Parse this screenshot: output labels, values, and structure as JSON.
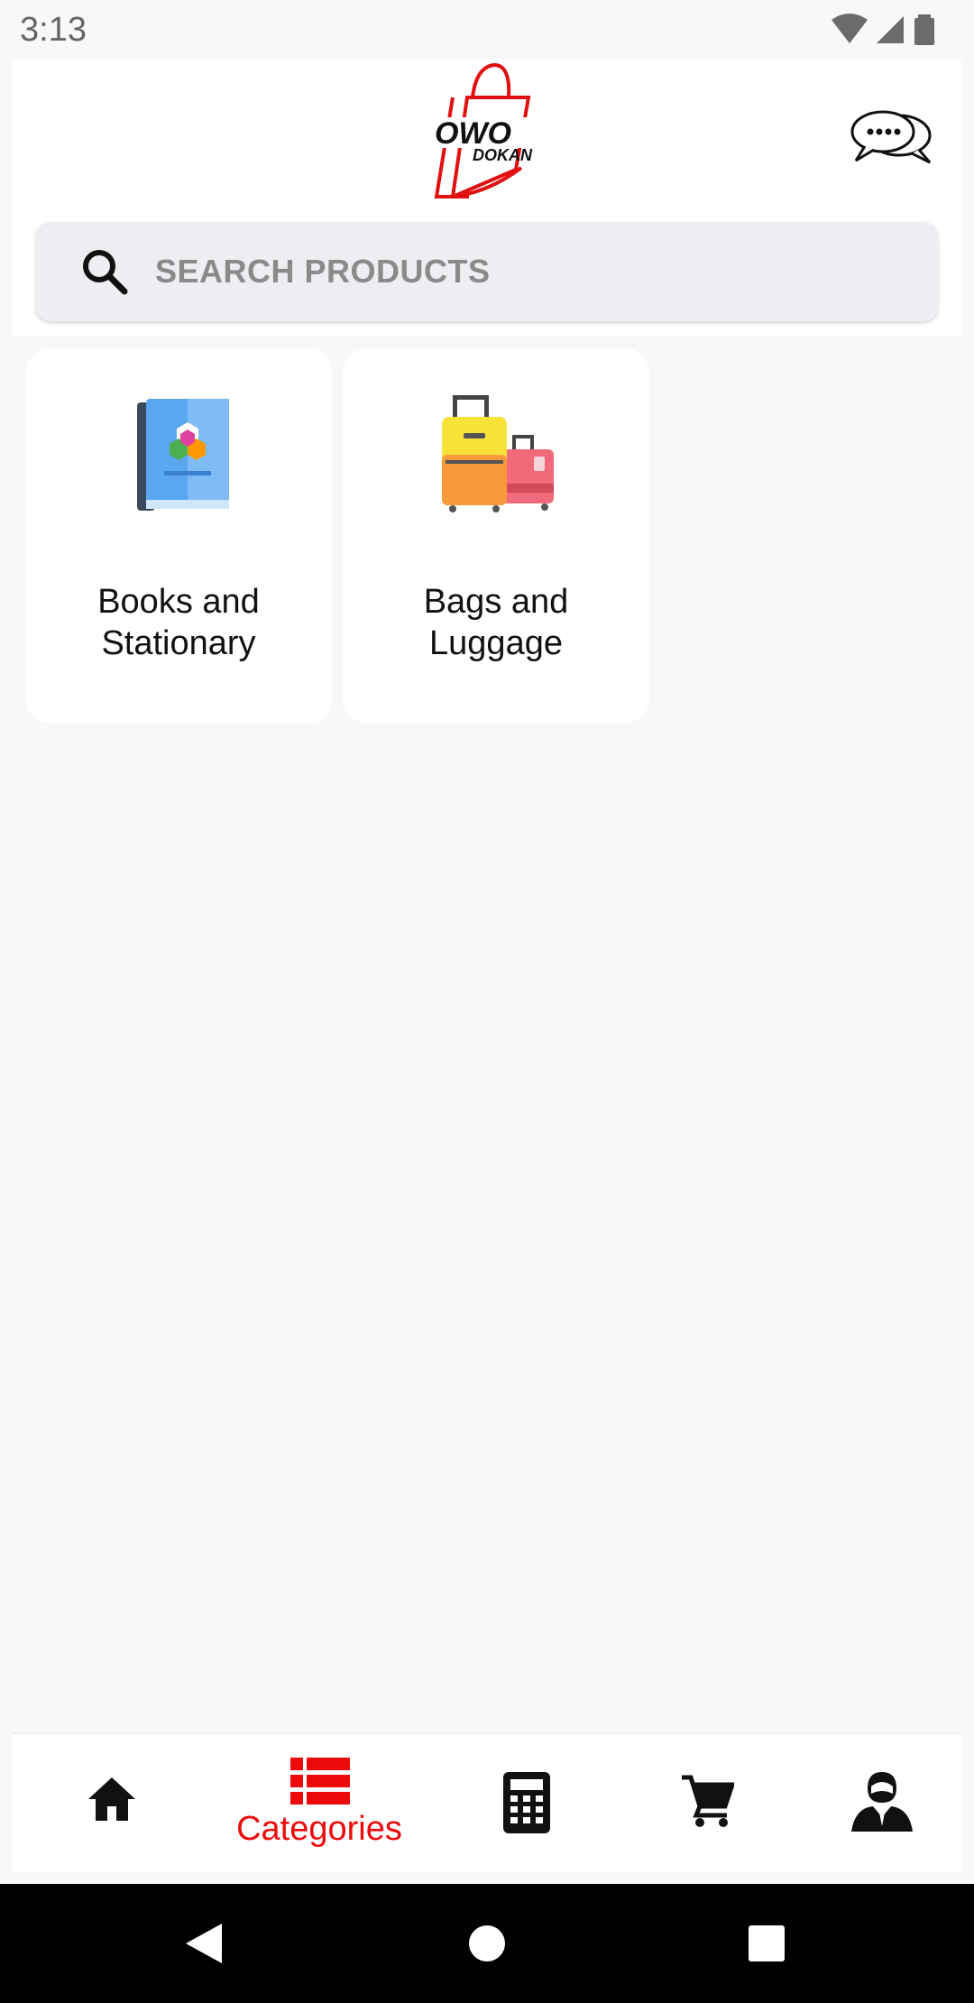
{
  "status_bar": {
    "time": "3:13",
    "icons": [
      "wifi-icon",
      "cell-signal-icon",
      "battery-icon"
    ]
  },
  "header": {
    "logo": {
      "line1": "OWO",
      "line2": "DOKAN"
    },
    "chat_icon": "chat-bubbles-icon"
  },
  "search": {
    "placeholder": "SEARCH PRODUCTS",
    "value": ""
  },
  "categories": [
    {
      "label": "Books and\nStationary",
      "icon": "book-icon"
    },
    {
      "label": "Bags and\nLuggage",
      "icon": "luggage-icon"
    }
  ],
  "bottom_nav": {
    "items": [
      {
        "icon": "home-icon",
        "label": ""
      },
      {
        "icon": "categories-list-icon",
        "label": "Categories",
        "active": true
      },
      {
        "icon": "calculator-icon",
        "label": ""
      },
      {
        "icon": "cart-icon",
        "label": ""
      },
      {
        "icon": "profile-icon",
        "label": ""
      }
    ]
  },
  "system_nav": [
    "back-icon",
    "home-circle-icon",
    "recents-icon"
  ],
  "colors": {
    "accent": "#ee0a0a",
    "background": "#f8f8f8",
    "card": "#ffffff",
    "search_bg": "#eceef1"
  }
}
